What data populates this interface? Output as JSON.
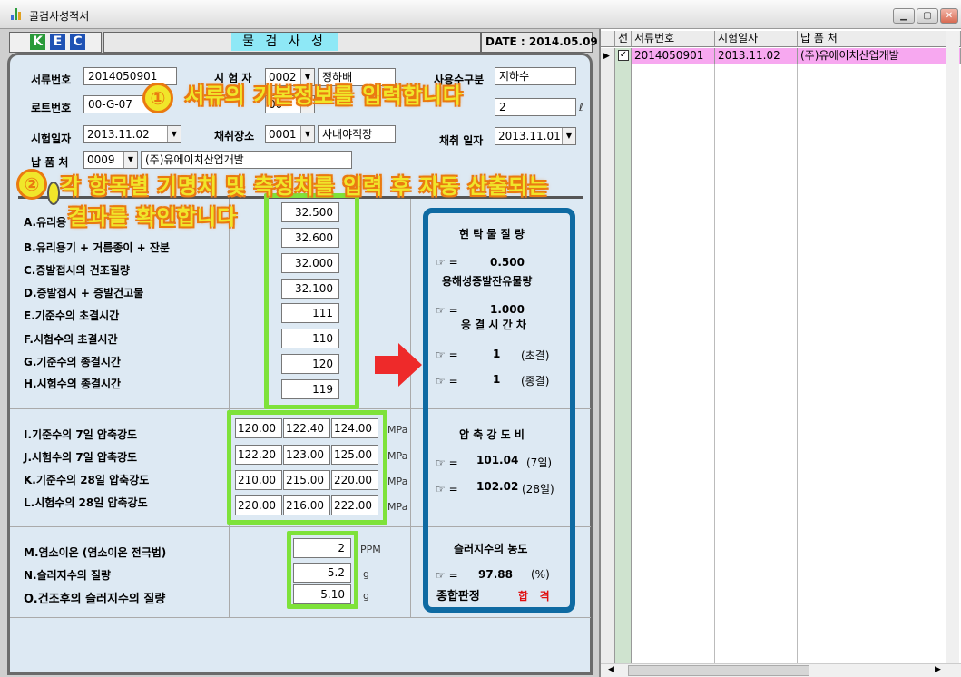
{
  "window": {
    "title": "골검사성적서"
  },
  "header": {
    "logo": [
      "K",
      "E",
      "C"
    ],
    "logo_colors": [
      "#2a9a3a",
      "#1f52b4",
      "#1f52b4"
    ],
    "title": "물 검 사 성 적 서",
    "date": "DATE :  2014.05.09"
  },
  "form": {
    "doc_no_label": "서류번호",
    "doc_no": "2014050901",
    "tester_label": "시 험 자",
    "tester_code": "0002",
    "tester_name": "정하배",
    "water_label": "사용수구분",
    "water": "지하수",
    "lot_label": "로트번호",
    "lot": "00-G-07",
    "row2_code": "00",
    "sample_unit": "ℓ",
    "sample_value": "2",
    "date_label": "시험일자",
    "date": "2013.11.02",
    "place_label": "채취장소",
    "place_code": "0001",
    "place_name": "사내야적장",
    "collect_label": "채취 일자",
    "collect_date": "2013.11.01",
    "vendor_label": "납 품 처",
    "vendor_code": "0009",
    "vendor_name": "(주)유에이치산업개발"
  },
  "items": {
    "a": "A.유리용",
    "b": "B.유리용기 + 거름종이 + 잔분",
    "c": "C.증발접시의 건조질량",
    "d": "D.증발접시 + 증발건고물",
    "e": "E.기준수의 초결시간",
    "f": "F.시험수의 초결시간",
    "g": "G.기준수의 종결시간",
    "h": "H.시험수의 종결시간",
    "i": "I.기준수의 7일 압축강도",
    "j": "J.시험수의 7일 압축강도",
    "k": "K.기준수의 28일 압축강도",
    "l": "L.시험수의 28일 압축강도",
    "m": "M.염소이온 (염소이온 전극법)",
    "n": "N.슬러지수의 질량",
    "o": "O.건조후의 슬러지수의 질량"
  },
  "values": {
    "a": "32.500",
    "b": "32.600",
    "c": "32.000",
    "d": "32.100",
    "e": "111",
    "f": "110",
    "g": "120",
    "h": "119",
    "i": [
      "120.00",
      "122.40",
      "124.00"
    ],
    "j": [
      "122.20",
      "123.00",
      "125.00"
    ],
    "k": [
      "210.00",
      "215.00",
      "220.00"
    ],
    "l": [
      "220.00",
      "216.00",
      "222.00"
    ],
    "m": "2",
    "n": "5.2",
    "o": "5.10"
  },
  "units": {
    "mpa": "MPa",
    "ppm": "PPM",
    "g": "g"
  },
  "results": {
    "sus_title": "현 탁 물 질 량",
    "sus_value": "0.500",
    "eq": "☞ =",
    "res_title": "용해성증발잔유물량",
    "res_value": "1.000",
    "set_title": "응 결 시 간 차",
    "set_init": "1",
    "set_init_lbl": "(초결)",
    "set_final": "1",
    "set_final_lbl": "(종결)",
    "comp_title": "압 축 강 도 비",
    "comp7": "101.04",
    "comp7_lbl": "(7일)",
    "comp28": "102.02",
    "comp28_lbl": "(28일)",
    "sludge_title": "슬러지수의 농도",
    "sludge": "97.88",
    "sludge_unit": "(%)",
    "judge_label": "종합판정",
    "judge": "합   격"
  },
  "overlays": {
    "n1": "①",
    "t1": "서류의 기본정보를 입력합니다",
    "n2": "②",
    "t2a": "각 항목별 기명치 및 측정치를 입력 후 자동 산출되는",
    "t2b": "결과를 확인합니다"
  },
  "grid": {
    "headers": [
      "선",
      "서류번호",
      "시험일자",
      "납 품 처"
    ],
    "rows": [
      {
        "doc": "2014050901",
        "date": "2013.11.02",
        "vendor": "(주)유에이치산업개발",
        "checked": true
      }
    ],
    "highlight": "#f7a8f0"
  }
}
